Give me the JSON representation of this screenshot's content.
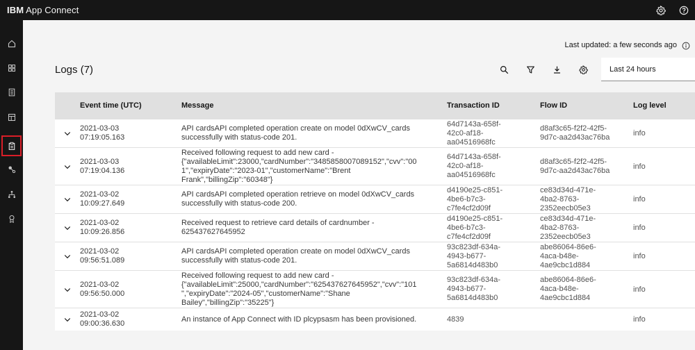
{
  "app": {
    "brand_bold": "IBM",
    "brand_name": "App Connect"
  },
  "topbar": {
    "icons": [
      "settings-icon",
      "help-icon"
    ]
  },
  "sidenav": {
    "items": [
      "home-icon",
      "dashboard-icon",
      "catalog-icon",
      "templates-icon",
      "logs-icon",
      "connectors-icon",
      "flows-icon",
      "badge-icon"
    ],
    "active": "logs-icon"
  },
  "status": {
    "last_updated": "Last updated: a few seconds ago"
  },
  "logs": {
    "title": "Logs (7)",
    "time_range": "Last 24 hours",
    "columns": {
      "event_time": "Event time (UTC)",
      "message": "Message",
      "transaction_id": "Transaction ID",
      "flow_id": "Flow ID",
      "log_level": "Log level"
    },
    "rows": [
      {
        "time1": "2021-03-03",
        "time2": "07:19:05.163",
        "msg1": "API cardsAPI completed operation create on model 0dXwCV_cards",
        "msg2": "successfully with status-code 201.",
        "msg3": "",
        "msg4": "",
        "txn1": "64d7143a-658f-",
        "txn2": "42c0-af18-",
        "txn3": "aa04516968fc",
        "flow1": "d8af3c65-f2f2-42f5-",
        "flow2": "9d7c-aa2d43ac76ba",
        "level": "info"
      },
      {
        "time1": "2021-03-03",
        "time2": "07:19:04.136",
        "msg1": "Received following request to add new card -",
        "msg2": "{\"availableLimit\":23000,\"cardNumber\":\"3485858007089152\",\"cvv\":\"00",
        "msg3": "1\",\"expiryDate\":\"2023-01\",\"customerName\":\"Brent",
        "msg4": "Frank\",\"billingZip\":\"60348\"}",
        "txn1": "64d7143a-658f-",
        "txn2": "42c0-af18-",
        "txn3": "aa04516968fc",
        "flow1": "d8af3c65-f2f2-42f5-",
        "flow2": "9d7c-aa2d43ac76ba",
        "level": "info"
      },
      {
        "time1": "2021-03-02",
        "time2": "10:09:27.649",
        "msg1": "API cardsAPI completed operation retrieve on model 0dXwCV_cards",
        "msg2": "successfully with status-code 200.",
        "msg3": "",
        "msg4": "",
        "txn1": "d4190e25-c851-",
        "txn2": "4be6-b7c3-",
        "txn3": "c7fe4cf2d09f",
        "flow1": "ce83d34d-471e-",
        "flow2": "4ba2-8763-",
        "flow3": "2352eecb05e3",
        "level": "info"
      },
      {
        "time1": "2021-03-02",
        "time2": "10:09:26.856",
        "msg1": "Received request to retrieve card details of cardnumber -",
        "msg2": "625437627645952",
        "msg3": "",
        "msg4": "",
        "txn1": "d4190e25-c851-",
        "txn2": "4be6-b7c3-",
        "txn3": "c7fe4cf2d09f",
        "flow1": "ce83d34d-471e-",
        "flow2": "4ba2-8763-",
        "flow3": "2352eecb05e3",
        "level": "info"
      },
      {
        "time1": "2021-03-02",
        "time2": "09:56:51.089",
        "msg1": "API cardsAPI completed operation create on model 0dXwCV_cards",
        "msg2": "successfully with status-code 201.",
        "msg3": "",
        "msg4": "",
        "txn1": "93c823df-634a-",
        "txn2": "4943-b677-",
        "txn3": "5a6814d483b0",
        "flow1": "abe86064-86e6-",
        "flow2": "4aca-b48e-",
        "flow3": "4ae9cbc1d884",
        "level": "info"
      },
      {
        "time1": "2021-03-02",
        "time2": "09:56:50.000",
        "msg1": "Received following request to add new card -",
        "msg2": "{\"availableLimit\":25000,\"cardNumber\":\"625437627645952\",\"cvv\":\"101",
        "msg3": "\",\"expiryDate\":\"2024-05\",\"customerName\":\"Shane",
        "msg4": "Bailey\",\"billingZip\":\"35225\"}",
        "txn1": "93c823df-634a-",
        "txn2": "4943-b677-",
        "txn3": "5a6814d483b0",
        "flow1": "abe86064-86e6-",
        "flow2": "4aca-b48e-",
        "flow3": "4ae9cbc1d884",
        "level": "info"
      },
      {
        "time1": "2021-03-02",
        "time2": "09:00:36.630",
        "msg1": "An instance of App Connect with ID plcypsasm has been provisioned.",
        "msg2": "",
        "msg3": "",
        "msg4": "",
        "txn1": "4839",
        "txn2": "",
        "txn3": "",
        "flow1": "",
        "flow2": "",
        "flow3": "",
        "level": "info"
      }
    ]
  }
}
